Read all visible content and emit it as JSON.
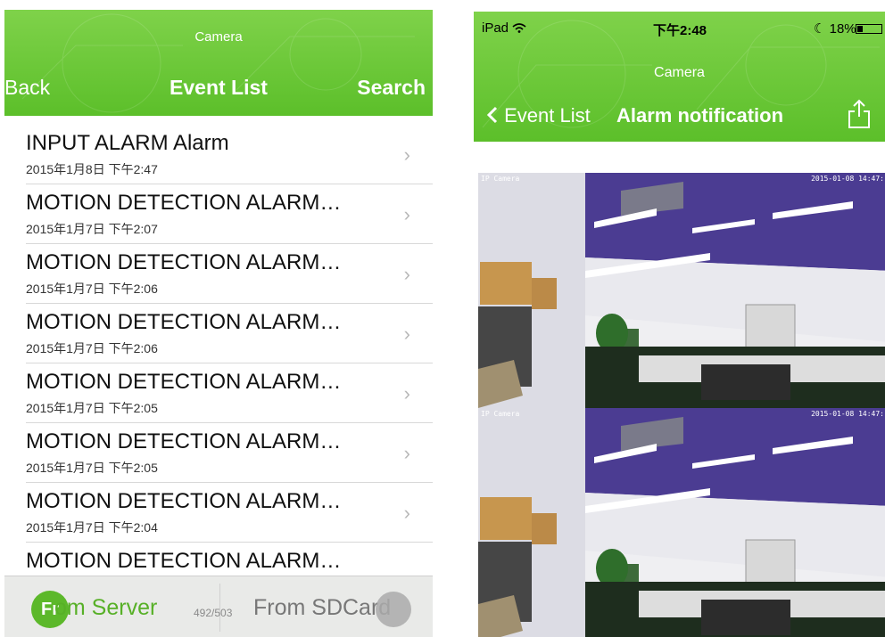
{
  "left": {
    "nav": {
      "app_title": "Camera",
      "back_label": "Back",
      "title": "Event List",
      "search_label": "Search"
    },
    "events": [
      {
        "title": "INPUT ALARM Alarm",
        "time": "2015年1月8日 下午2:47"
      },
      {
        "title": "MOTION DETECTION ALARM…",
        "time": "2015年1月7日 下午2:07"
      },
      {
        "title": "MOTION DETECTION ALARM…",
        "time": "2015年1月7日 下午2:06"
      },
      {
        "title": "MOTION DETECTION ALARM…",
        "time": "2015年1月7日 下午2:06"
      },
      {
        "title": "MOTION DETECTION ALARM…",
        "time": "2015年1月7日 下午2:05"
      },
      {
        "title": "MOTION DETECTION ALARM…",
        "time": "2015年1月7日 下午2:05"
      },
      {
        "title": "MOTION DETECTION ALARM…",
        "time": "2015年1月7日 下午2:04"
      },
      {
        "title": "MOTION DETECTION ALARM…",
        "time": ""
      }
    ],
    "tabbar": {
      "server_icon_text": "Fr",
      "server_label": "om Server",
      "count": "492/503",
      "sdcard_label": "From SDCard"
    }
  },
  "right": {
    "status": {
      "device": "iPad",
      "time": "下午2:48",
      "battery": "18%"
    },
    "nav": {
      "app_title": "Camera",
      "back_label": "Event List",
      "title": "Alarm notification"
    },
    "snapshots": [
      {
        "label": "IP Camera",
        "timestamp": "2015-01-08 14:47:"
      },
      {
        "label": "IP Camera",
        "timestamp": "2015-01-08 14:47:"
      }
    ]
  },
  "colors": {
    "nav_green": "#5cbf2a",
    "tab_green": "#57b027"
  }
}
